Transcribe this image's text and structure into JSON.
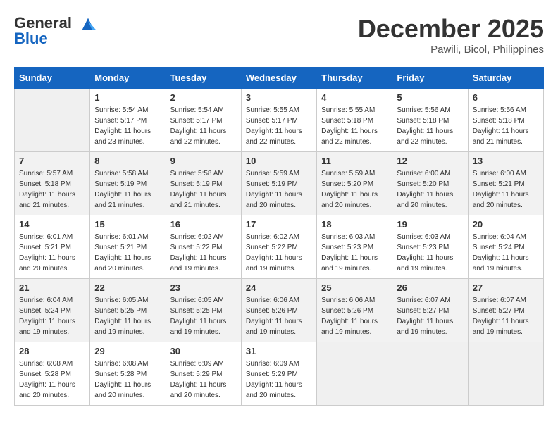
{
  "header": {
    "logo_line1": "General",
    "logo_line2": "Blue",
    "month": "December 2025",
    "location": "Pawili, Bicol, Philippines"
  },
  "weekdays": [
    "Sunday",
    "Monday",
    "Tuesday",
    "Wednesday",
    "Thursday",
    "Friday",
    "Saturday"
  ],
  "weeks": [
    [
      {
        "day": "",
        "info": ""
      },
      {
        "day": "1",
        "info": "Sunrise: 5:54 AM\nSunset: 5:17 PM\nDaylight: 11 hours\nand 23 minutes."
      },
      {
        "day": "2",
        "info": "Sunrise: 5:54 AM\nSunset: 5:17 PM\nDaylight: 11 hours\nand 22 minutes."
      },
      {
        "day": "3",
        "info": "Sunrise: 5:55 AM\nSunset: 5:17 PM\nDaylight: 11 hours\nand 22 minutes."
      },
      {
        "day": "4",
        "info": "Sunrise: 5:55 AM\nSunset: 5:18 PM\nDaylight: 11 hours\nand 22 minutes."
      },
      {
        "day": "5",
        "info": "Sunrise: 5:56 AM\nSunset: 5:18 PM\nDaylight: 11 hours\nand 22 minutes."
      },
      {
        "day": "6",
        "info": "Sunrise: 5:56 AM\nSunset: 5:18 PM\nDaylight: 11 hours\nand 21 minutes."
      }
    ],
    [
      {
        "day": "7",
        "info": "Sunrise: 5:57 AM\nSunset: 5:18 PM\nDaylight: 11 hours\nand 21 minutes."
      },
      {
        "day": "8",
        "info": "Sunrise: 5:58 AM\nSunset: 5:19 PM\nDaylight: 11 hours\nand 21 minutes."
      },
      {
        "day": "9",
        "info": "Sunrise: 5:58 AM\nSunset: 5:19 PM\nDaylight: 11 hours\nand 21 minutes."
      },
      {
        "day": "10",
        "info": "Sunrise: 5:59 AM\nSunset: 5:19 PM\nDaylight: 11 hours\nand 20 minutes."
      },
      {
        "day": "11",
        "info": "Sunrise: 5:59 AM\nSunset: 5:20 PM\nDaylight: 11 hours\nand 20 minutes."
      },
      {
        "day": "12",
        "info": "Sunrise: 6:00 AM\nSunset: 5:20 PM\nDaylight: 11 hours\nand 20 minutes."
      },
      {
        "day": "13",
        "info": "Sunrise: 6:00 AM\nSunset: 5:21 PM\nDaylight: 11 hours\nand 20 minutes."
      }
    ],
    [
      {
        "day": "14",
        "info": "Sunrise: 6:01 AM\nSunset: 5:21 PM\nDaylight: 11 hours\nand 20 minutes."
      },
      {
        "day": "15",
        "info": "Sunrise: 6:01 AM\nSunset: 5:21 PM\nDaylight: 11 hours\nand 20 minutes."
      },
      {
        "day": "16",
        "info": "Sunrise: 6:02 AM\nSunset: 5:22 PM\nDaylight: 11 hours\nand 19 minutes."
      },
      {
        "day": "17",
        "info": "Sunrise: 6:02 AM\nSunset: 5:22 PM\nDaylight: 11 hours\nand 19 minutes."
      },
      {
        "day": "18",
        "info": "Sunrise: 6:03 AM\nSunset: 5:23 PM\nDaylight: 11 hours\nand 19 minutes."
      },
      {
        "day": "19",
        "info": "Sunrise: 6:03 AM\nSunset: 5:23 PM\nDaylight: 11 hours\nand 19 minutes."
      },
      {
        "day": "20",
        "info": "Sunrise: 6:04 AM\nSunset: 5:24 PM\nDaylight: 11 hours\nand 19 minutes."
      }
    ],
    [
      {
        "day": "21",
        "info": "Sunrise: 6:04 AM\nSunset: 5:24 PM\nDaylight: 11 hours\nand 19 minutes."
      },
      {
        "day": "22",
        "info": "Sunrise: 6:05 AM\nSunset: 5:25 PM\nDaylight: 11 hours\nand 19 minutes."
      },
      {
        "day": "23",
        "info": "Sunrise: 6:05 AM\nSunset: 5:25 PM\nDaylight: 11 hours\nand 19 minutes."
      },
      {
        "day": "24",
        "info": "Sunrise: 6:06 AM\nSunset: 5:26 PM\nDaylight: 11 hours\nand 19 minutes."
      },
      {
        "day": "25",
        "info": "Sunrise: 6:06 AM\nSunset: 5:26 PM\nDaylight: 11 hours\nand 19 minutes."
      },
      {
        "day": "26",
        "info": "Sunrise: 6:07 AM\nSunset: 5:27 PM\nDaylight: 11 hours\nand 19 minutes."
      },
      {
        "day": "27",
        "info": "Sunrise: 6:07 AM\nSunset: 5:27 PM\nDaylight: 11 hours\nand 19 minutes."
      }
    ],
    [
      {
        "day": "28",
        "info": "Sunrise: 6:08 AM\nSunset: 5:28 PM\nDaylight: 11 hours\nand 20 minutes."
      },
      {
        "day": "29",
        "info": "Sunrise: 6:08 AM\nSunset: 5:28 PM\nDaylight: 11 hours\nand 20 minutes."
      },
      {
        "day": "30",
        "info": "Sunrise: 6:09 AM\nSunset: 5:29 PM\nDaylight: 11 hours\nand 20 minutes."
      },
      {
        "day": "31",
        "info": "Sunrise: 6:09 AM\nSunset: 5:29 PM\nDaylight: 11 hours\nand 20 minutes."
      },
      {
        "day": "",
        "info": ""
      },
      {
        "day": "",
        "info": ""
      },
      {
        "day": "",
        "info": ""
      }
    ]
  ]
}
